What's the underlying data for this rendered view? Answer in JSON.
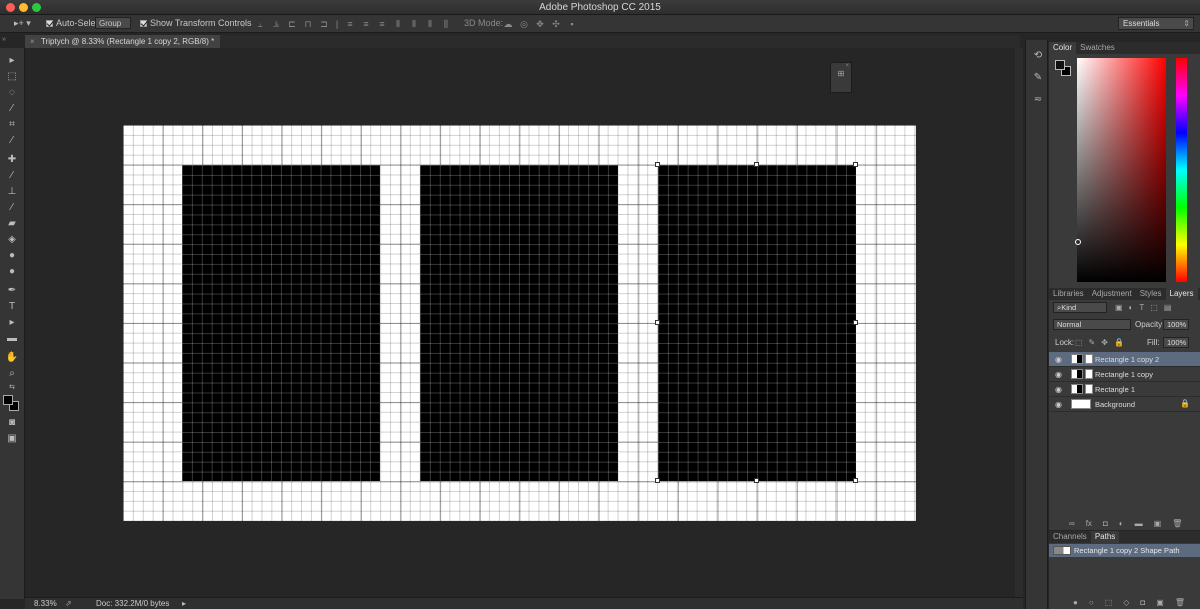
{
  "app": {
    "title": "Adobe Photoshop CC 2015"
  },
  "options_bar": {
    "auto_select_label": "Auto-Select:",
    "auto_select_value": "Group",
    "show_transform_label": "Show Transform Controls",
    "mode_3d_label": "3D Mode:",
    "workspace": "Essentials"
  },
  "document": {
    "tab_title": "Triptych @ 8.33% (Rectangle 1 copy 2, RGB/8) *",
    "zoom": "8.33%",
    "doc_info": "Doc: 332.2M/0 bytes"
  },
  "color_panel": {
    "tabs": [
      "Color",
      "Swatches"
    ],
    "active": "Color"
  },
  "layers_panel": {
    "tabs": [
      "Libraries",
      "Adjustment",
      "Styles",
      "Layers"
    ],
    "active": "Layers",
    "filter_kind": "Kind",
    "blend_mode": "Normal",
    "opacity_label": "Opacity:",
    "opacity": "100%",
    "lock_label": "Lock:",
    "fill_label": "Fill:",
    "fill": "100%",
    "layers": [
      {
        "name": "Rectangle 1 copy 2",
        "selected": true
      },
      {
        "name": "Rectangle 1 copy",
        "selected": false
      },
      {
        "name": "Rectangle 1",
        "selected": false
      },
      {
        "name": "Background",
        "selected": false
      }
    ]
  },
  "paths_panel": {
    "tabs": [
      "Channels",
      "Paths"
    ],
    "active": "Paths",
    "paths": [
      {
        "name": "Rectangle 1 copy 2 Shape Path"
      }
    ]
  }
}
